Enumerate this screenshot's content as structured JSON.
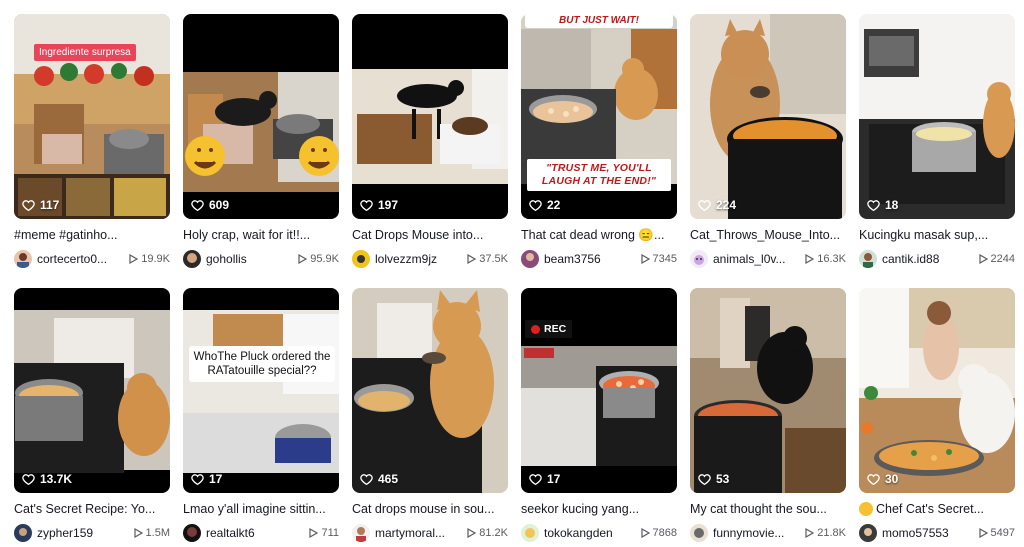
{
  "colors": {
    "text": "#161823",
    "muted": "#5a5b62",
    "accent": "#e8445a"
  },
  "cards": [
    {
      "likes": "117",
      "caption": "#meme #gatinho...",
      "user": "cortecerto0...",
      "plays": "19.9K",
      "overlay": "Ingrediente surpresa"
    },
    {
      "likes": "609",
      "caption": "Holy crap, wait for it!!...",
      "user": "gohollis",
      "plays": "95.9K"
    },
    {
      "likes": "197",
      "caption": "Cat Drops Mouse into...",
      "user": "lolvezzm9jz",
      "plays": "37.5K"
    },
    {
      "likes": "22",
      "caption": "That cat dead wrong 😑...",
      "user": "beam3756",
      "plays": "7345",
      "overlay_top": "BUT JUST WAIT!",
      "overlay": "\"TRUST ME, YOU'LL LAUGH AT THE END!\""
    },
    {
      "likes": "224",
      "caption": "Cat_Throws_Mouse_Into...",
      "user": "animals_l0v...",
      "plays": "16.3K"
    },
    {
      "likes": "18",
      "caption": "Kucingku masak sup,...",
      "user": "cantik.id88",
      "plays": "2244"
    },
    {
      "likes": "13.7K",
      "caption": "Cat's Secret Recipe: Yo...",
      "user": "zypher159",
      "plays": "1.5M"
    },
    {
      "likes": "17",
      "caption": "Lmao y'all imagine sittin...",
      "user": "realtalkt6",
      "plays": "711",
      "overlay": "WhoThe Pluck ordered the RATatouille special??"
    },
    {
      "likes": "465",
      "caption": "Cat drops mouse in sou...",
      "user": "martymoral...",
      "plays": "81.2K"
    },
    {
      "likes": "17",
      "caption": "seekor kucing yang...",
      "user": "tokokangden",
      "plays": "7868",
      "overlay": "REC"
    },
    {
      "likes": "53",
      "caption": "My cat thought the sou...",
      "user": "funnymovie...",
      "plays": "21.8K"
    },
    {
      "likes": "30",
      "caption": "Chef Cat's Secret...",
      "user": "momo57553",
      "plays": "5497"
    }
  ],
  "icons": {
    "likes": "heart-outline-icon",
    "plays": "play-outline-icon"
  }
}
